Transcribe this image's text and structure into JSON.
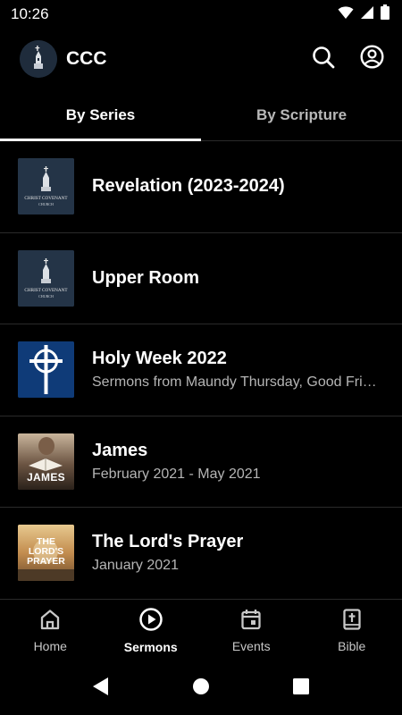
{
  "status_bar": {
    "time": "10:26"
  },
  "app_bar": {
    "title": "CCC"
  },
  "tabs": [
    {
      "label": "By Series",
      "active": true
    },
    {
      "label": "By Scripture",
      "active": false
    }
  ],
  "series": [
    {
      "title": "Revelation (2023-2024)",
      "subtitle": "",
      "thumb_text": "CHRIST COVENANT",
      "thumb_sub": "CHURCH"
    },
    {
      "title": "Upper Room",
      "subtitle": "",
      "thumb_text": "CHRIST COVENANT",
      "thumb_sub": "CHURCH"
    },
    {
      "title": "Holy Week 2022",
      "subtitle": "Sermons from Maundy Thursday, Good Friday and Easter Sunday"
    },
    {
      "title": "James",
      "subtitle": "February 2021 - May 2021",
      "thumb_text": "JAMES"
    },
    {
      "title": "The Lord's Prayer",
      "subtitle": "January 2021",
      "thumb_text": "THE LORD'S PRAYER"
    }
  ],
  "bottom_nav": [
    {
      "label": "Home",
      "icon": "home-icon",
      "active": false
    },
    {
      "label": "Sermons",
      "icon": "play-circle-icon",
      "active": true
    },
    {
      "label": "Events",
      "icon": "calendar-icon",
      "active": false
    },
    {
      "label": "Bible",
      "icon": "bible-icon",
      "active": false
    }
  ],
  "colors": {
    "background": "#000000",
    "text": "#ffffff",
    "muted": "#b5b5b5",
    "divider": "#2a2a2a",
    "holy_week_blue": "#0f3b78"
  }
}
